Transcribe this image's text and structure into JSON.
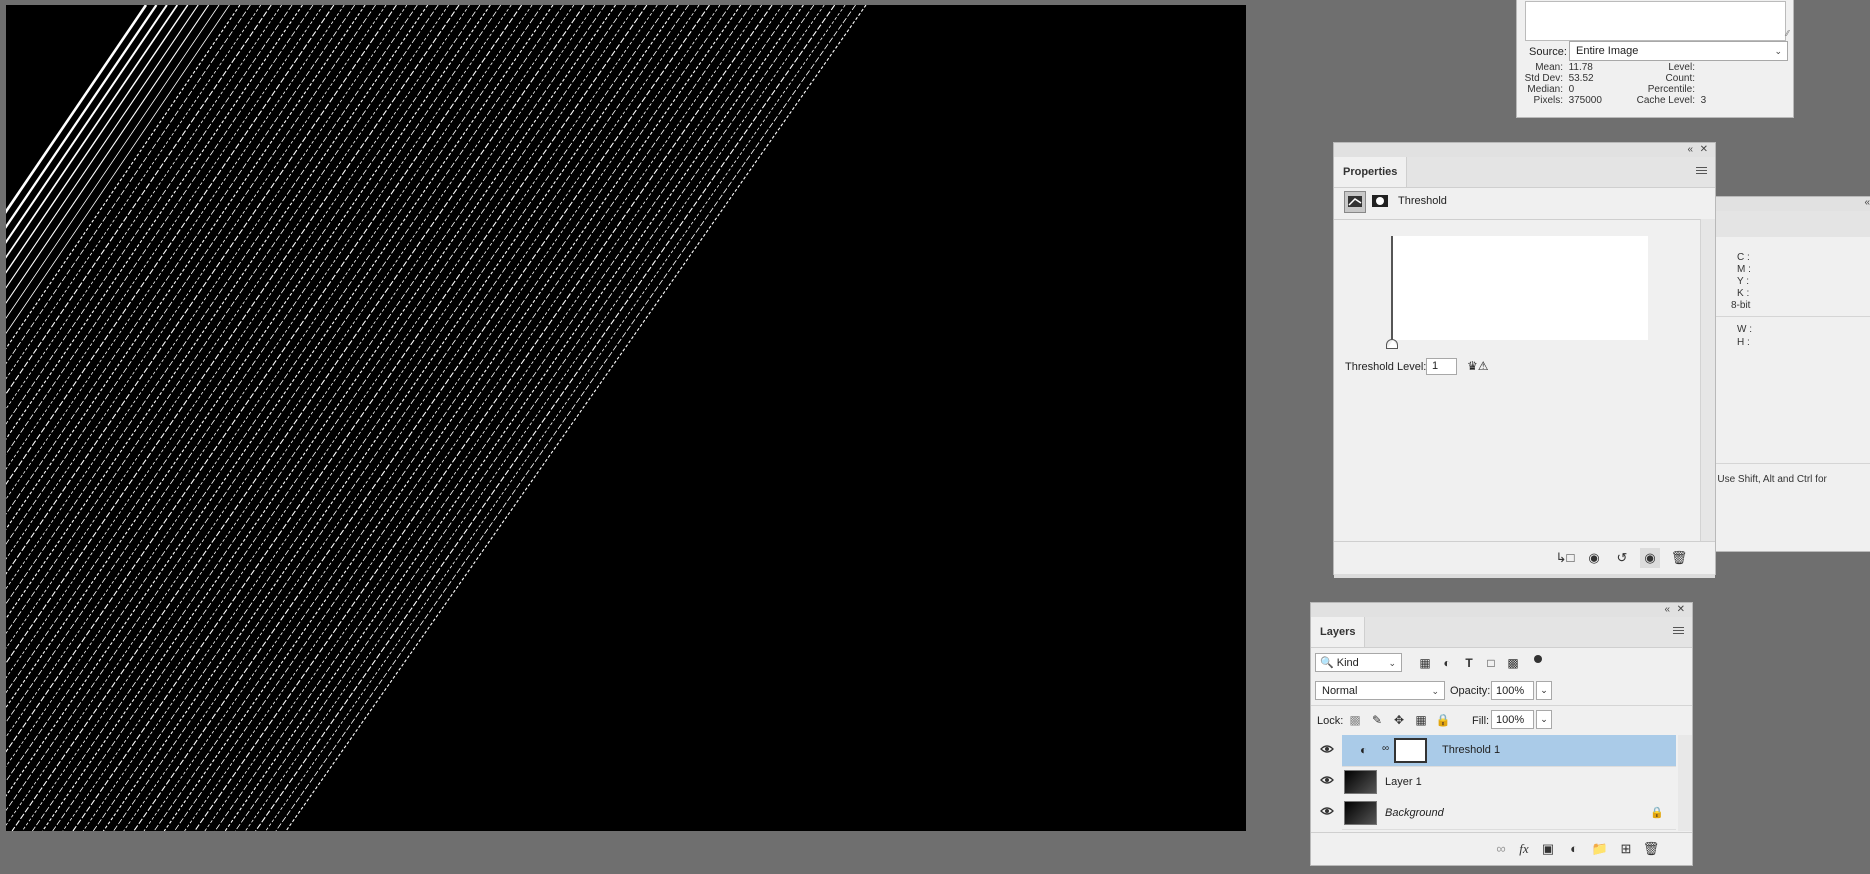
{
  "histogram": {
    "source_label": "Source:",
    "source_value": "Entire Image",
    "stats_left": [
      {
        "key": "Mean:",
        "value": "11.78"
      },
      {
        "key": "Std Dev:",
        "value": "53.52"
      },
      {
        "key": "Median:",
        "value": "0"
      },
      {
        "key": "Pixels:",
        "value": "375000"
      }
    ],
    "stats_right": [
      {
        "key": "Level:",
        "value": ""
      },
      {
        "key": "Count:",
        "value": ""
      },
      {
        "key": "Percentile:",
        "value": ""
      },
      {
        "key": "Cache Level:",
        "value": "3"
      }
    ]
  },
  "properties": {
    "tab_label": "Properties",
    "adjustment_name": "Threshold",
    "threshold_label": "Threshold Level:",
    "threshold_value": "1"
  },
  "info": {
    "cmyk": [
      "C :",
      "M :",
      "Y :",
      "K :"
    ],
    "bit_depth": "8-bit",
    "wh": [
      "W :",
      "H :"
    ],
    "hint": "Use Shift, Alt and Ctrl for"
  },
  "layers": {
    "tab_label": "Layers",
    "filter_kind": "Kind",
    "blend_mode": "Normal",
    "opacity_label": "Opacity:",
    "opacity_value": "100%",
    "lock_label": "Lock:",
    "fill_label": "Fill:",
    "fill_value": "100%",
    "items": [
      {
        "name": "Threshold 1"
      },
      {
        "name": "Layer 1"
      },
      {
        "name": "Background"
      }
    ]
  },
  "colors": {
    "workspace": "#6f6f6f",
    "panel": "#f0f0f0",
    "selected_layer": "#aacbe8",
    "canvas": "#000000"
  }
}
